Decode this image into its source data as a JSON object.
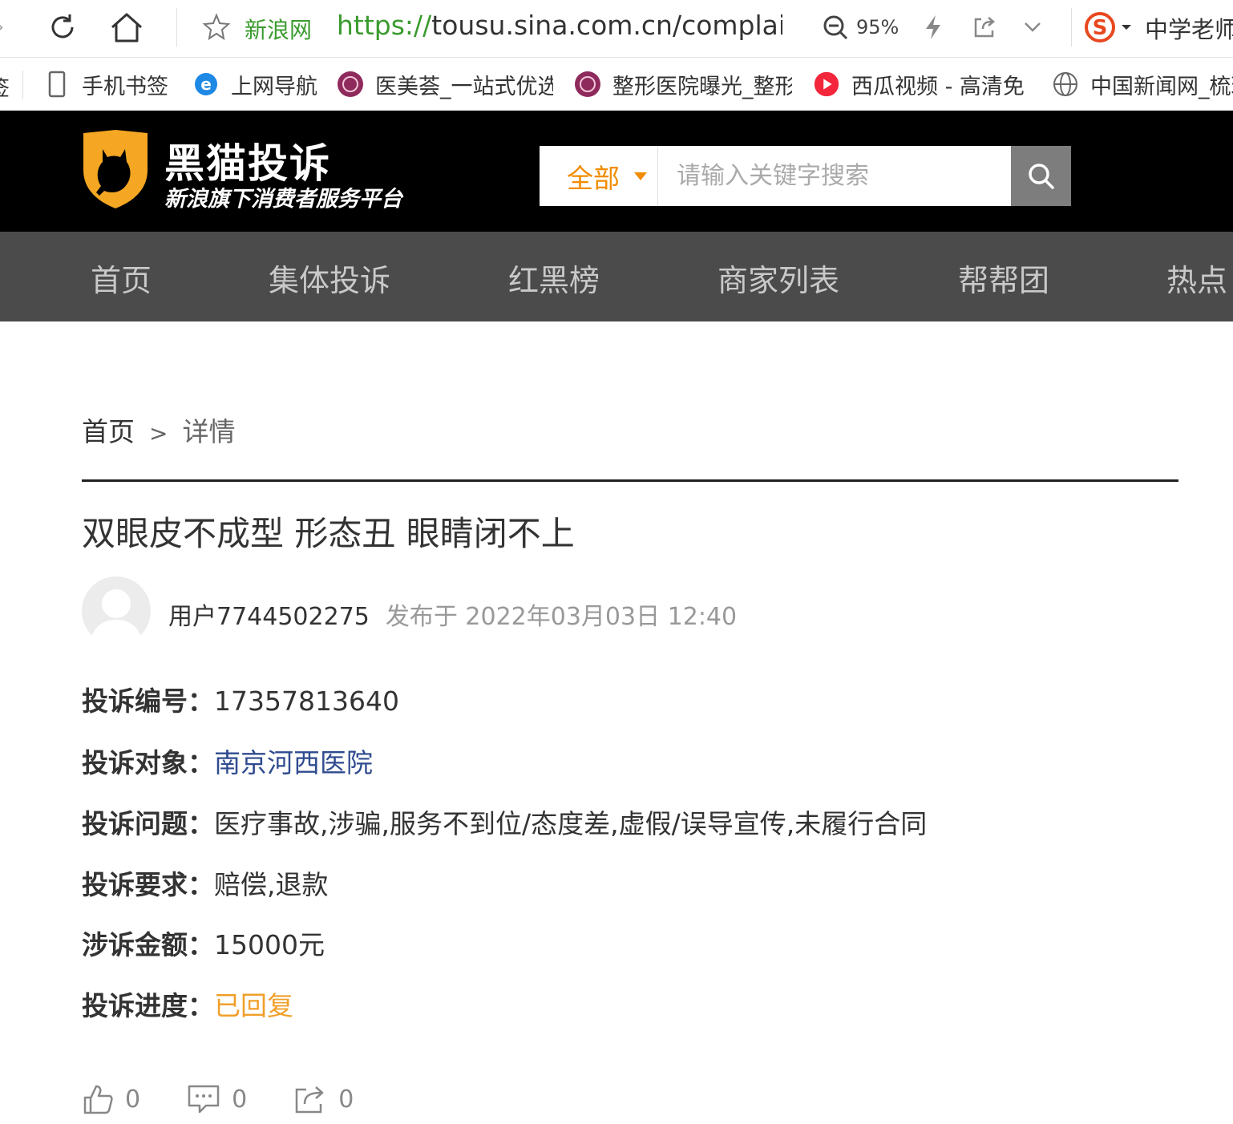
{
  "browser": {
    "site_label": "新浪网",
    "url_proto": "https://",
    "url_rest": "tousu.sina.com.cn/complaint/",
    "zoom": "95%",
    "search_hint": "中学老师"
  },
  "bookmarks": [
    {
      "label": "手机书签",
      "icon": "phone-icon"
    },
    {
      "label": "上网导航",
      "icon": "ie-icon"
    },
    {
      "label": "医美荟_一站式优选",
      "icon": "yimeihui-icon"
    },
    {
      "label": "整形医院曝光_整形",
      "icon": "yimeihui-icon"
    },
    {
      "label": "西瓜视频 - 高清免",
      "icon": "xigua-icon"
    },
    {
      "label": "中国新闻网_梳理",
      "icon": "globe-icon"
    }
  ],
  "site": {
    "title": "黑猫投诉",
    "subtitle": "新浪旗下消费者服务平台",
    "search_category": "全部",
    "search_placeholder": "请输入关键字搜索"
  },
  "nav": [
    "首页",
    "集体投诉",
    "红黑榜",
    "商家列表",
    "帮帮团",
    "热点"
  ],
  "breadcrumb": {
    "home": "首页",
    "sep": ">",
    "current": "详情"
  },
  "complaint": {
    "title": "双眼皮不成型 形态丑 眼睛闭不上",
    "author": "用户7744502275",
    "published": "发布于 2022年03月03日 12:40",
    "fields": [
      {
        "key": "投诉编号：",
        "value": "17357813640"
      },
      {
        "key": "投诉对象：",
        "value": "南京河西医院"
      },
      {
        "key": "投诉问题：",
        "value": "医疗事故,涉骗,服务不到位/态度差,虚假/误导宣传,未履行合同"
      },
      {
        "key": "投诉要求：",
        "value": "赔偿,退款"
      },
      {
        "key": "涉诉金额：",
        "value": "15000元"
      },
      {
        "key": "投诉进度：",
        "value": "已回复"
      }
    ]
  },
  "actions": {
    "likes": "0",
    "comments": "0",
    "shares": "0"
  },
  "colors": {
    "brand_orange": "#f18c00",
    "status": "#f0a02a",
    "link": "#2f4b8f",
    "nav_bg": "#4b4b4b"
  }
}
